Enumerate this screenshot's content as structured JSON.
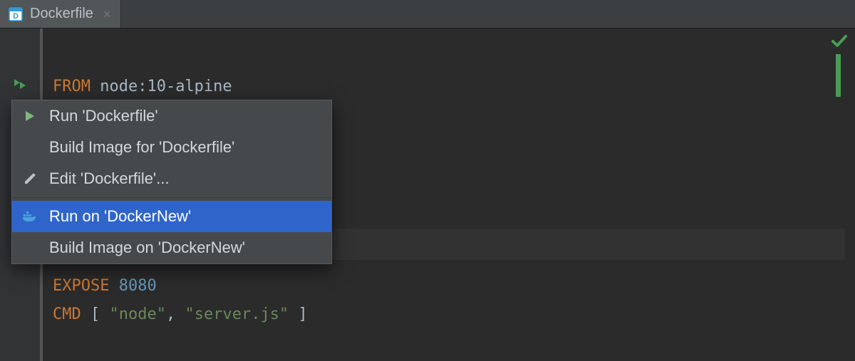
{
  "tab": {
    "title": "Dockerfile",
    "close_glyph": "×"
  },
  "editor": {
    "line1_kw": "FROM",
    "line1_img": "node:10-alpine",
    "line_expose_kw": "EXPOSE",
    "line_expose_port": "8080",
    "line_cmd_kw": "CMD",
    "line_cmd_open": " [ ",
    "line_cmd_arg1": "\"node\"",
    "line_cmd_comma": ", ",
    "line_cmd_arg2": "\"server.js\"",
    "line_cmd_close": " ]"
  },
  "menu": {
    "items": [
      {
        "label": "Run 'Dockerfile'",
        "icon": "run-triangle"
      },
      {
        "label": "Build Image for 'Dockerfile'",
        "icon": ""
      },
      {
        "label": "Edit 'Dockerfile'...",
        "icon": "pencil"
      },
      {
        "label": "Run on 'DockerNew'",
        "icon": "docker",
        "selected": true
      },
      {
        "label": "Build Image on 'DockerNew'",
        "icon": ""
      }
    ]
  }
}
